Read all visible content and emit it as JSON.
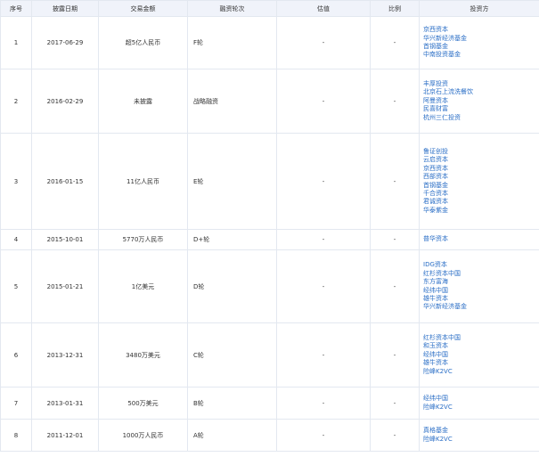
{
  "table": {
    "headers": [
      "序号",
      "披露日期",
      "交易金额",
      "融资轮次",
      "估值",
      "比例",
      "投资方"
    ],
    "rows": [
      {
        "no": "1",
        "date": "2017-06-29",
        "amount": "超5亿人民币",
        "round": "F轮",
        "valuation": "-",
        "ratio": "-",
        "investors": [
          "京西资本",
          "华兴新经济基金",
          "首钢基金",
          "中南投资基金"
        ]
      },
      {
        "no": "2",
        "date": "2016-02-29",
        "amount": "未披露",
        "round": "战略融资",
        "valuation": "-",
        "ratio": "-",
        "investors": [
          "丰厚投资",
          "北京石上流洗餐饮",
          "阿曼资本",
          "民喜财富",
          "杭州三仁投资"
        ]
      },
      {
        "no": "3",
        "date": "2016-01-15",
        "amount": "11亿人民币",
        "round": "E轮",
        "valuation": "-",
        "ratio": "-",
        "investors": [
          "鲁证创投",
          "云启资本",
          "京西资本",
          "西部资本",
          "首钢基金",
          "千合资本",
          "君诚资本",
          "华泰紫金"
        ]
      },
      {
        "no": "4",
        "date": "2015-10-01",
        "amount": "5770万人民币",
        "round": "D+轮",
        "valuation": "-",
        "ratio": "-",
        "investors": [
          "普华资本"
        ]
      },
      {
        "no": "5",
        "date": "2015-01-21",
        "amount": "1亿美元",
        "round": "D轮",
        "valuation": "-",
        "ratio": "-",
        "investors": [
          "IDG资本",
          "红杉资本中国",
          "东方富海",
          "经纬中国",
          "雄牛资本",
          "华兴新经济基金"
        ]
      },
      {
        "no": "6",
        "date": "2013-12-31",
        "amount": "3480万美元",
        "round": "C轮",
        "valuation": "-",
        "ratio": "-",
        "investors": [
          "红杉资本中国",
          "和玉资本",
          "经纬中国",
          "雄牛资本",
          "险峰K2VC"
        ]
      },
      {
        "no": "7",
        "date": "2013-01-31",
        "amount": "500万美元",
        "round": "B轮",
        "valuation": "-",
        "ratio": "-",
        "investors": [
          "经纬中国",
          "险峰K2VC"
        ]
      },
      {
        "no": "8",
        "date": "2011-12-01",
        "amount": "1000万人民币",
        "round": "A轮",
        "valuation": "-",
        "ratio": "-",
        "investors": [
          "真格基金",
          "险峰K2VC"
        ]
      }
    ]
  }
}
